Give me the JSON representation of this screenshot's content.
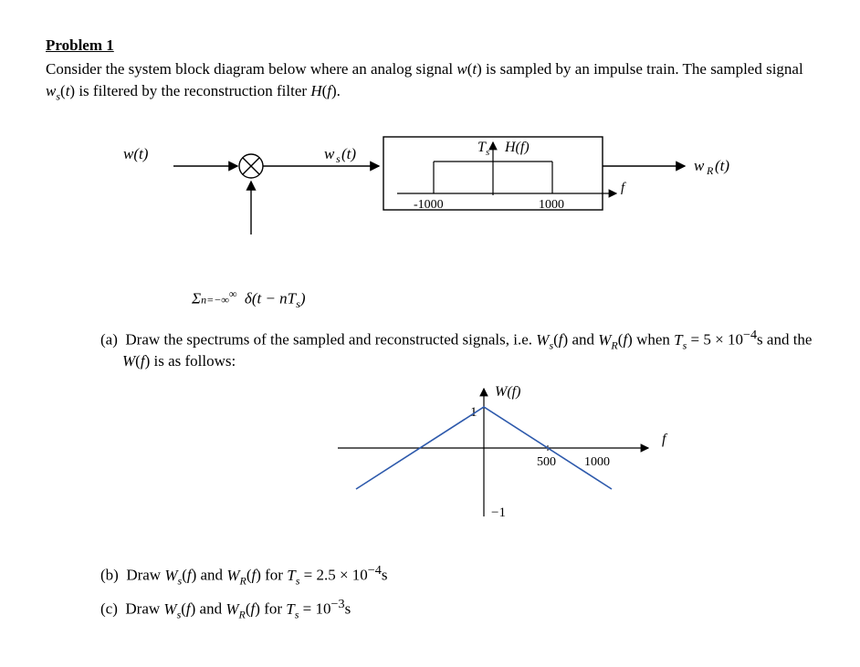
{
  "problem_title": "Problem 1",
  "intro_text": "Consider the system block diagram below where an analog signal w(t) is sampled by an impulse train. The sampled signal w_s(t) is filtered by the reconstruction filter H(f).",
  "diagram": {
    "in_label": "w(t)",
    "mid_label": "w_s(t)",
    "out_label": "w_R(t)",
    "filter_yaxis": "T_s",
    "filter_title": "H(f)",
    "filter_xlabel": "f",
    "filter_xmin": "-1000",
    "filter_xmax": "1000",
    "impulse_sum": "Σ_{n=-∞}^{∞} δ(t − nT_s)"
  },
  "part_a": {
    "label": "(a)",
    "text": "Draw the spectrums of the sampled and reconstructed signals, i.e. W_s(f) and W_R(f) when T_s = 5 × 10^{-4} s and the W(f) is as follows:"
  },
  "wf_plot": {
    "title": "W(f)",
    "xlabel": "f",
    "y_top": "1",
    "y_bot": "−1",
    "x1": "500",
    "x2": "1000"
  },
  "part_b": {
    "label": "(b)",
    "text": "Draw W_s(f) and W_R(f) for T_s = 2.5 × 10^{-4} s"
  },
  "part_c": {
    "label": "(c)",
    "text": "Draw W_s(f) and W_R(f) for T_s = 10^{-3} s"
  },
  "chart_data": [
    {
      "type": "line",
      "title": "H(f) reconstruction filter",
      "xlabel": "f",
      "ylabel": "T_s",
      "x": [
        -1000,
        -1000,
        1000,
        1000
      ],
      "y": [
        0,
        1,
        1,
        0
      ],
      "ylim": [
        0,
        1
      ],
      "note": "Ideal low-pass, cutoff 1000, gain T_s"
    },
    {
      "type": "line",
      "title": "W(f)",
      "xlabel": "f",
      "ylabel": "",
      "x": [
        -1000,
        0,
        1000
      ],
      "y": [
        -1,
        1,
        -1
      ],
      "ylim": [
        -1,
        1
      ],
      "xlim": [
        -1000,
        1000
      ],
      "xticks": [
        500,
        1000
      ]
    }
  ]
}
